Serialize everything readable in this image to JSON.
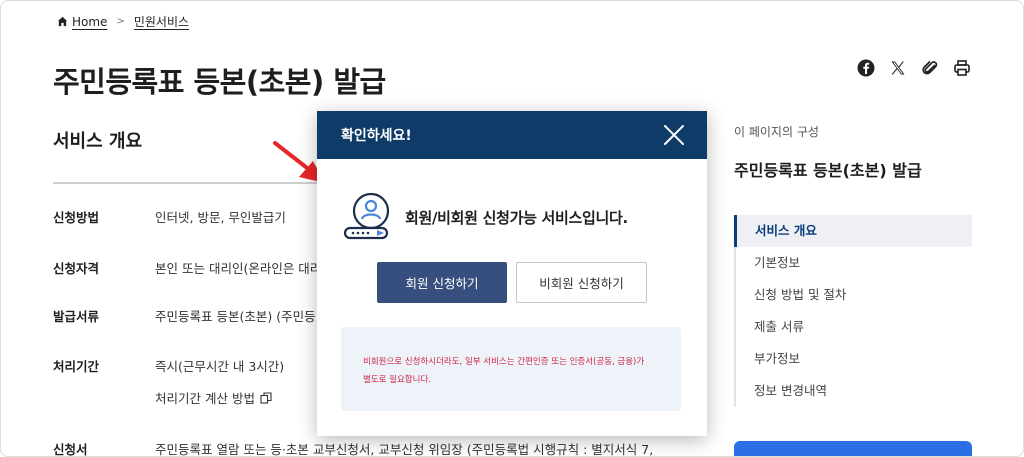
{
  "breadcrumb": {
    "home": "Home",
    "current": "민원서비스"
  },
  "page": {
    "title": "주민등록표 등본(초본) 발급"
  },
  "share_icons": [
    "facebook-icon",
    "x-icon",
    "paperclip-icon",
    "print-icon"
  ],
  "overview": {
    "title": "서비스 개요",
    "rows": [
      {
        "label": "신청방법",
        "value": "인터넷, 방문, 무인발급기"
      },
      {
        "label": "신청자격",
        "value": "본인 또는 대리인(온라인은 대리"
      },
      {
        "label": "발급서류",
        "value": "주민등록표 등본(초본) (주민등"
      },
      {
        "label": "처리기간",
        "value": "즉시(근무시간 내 3시간)"
      },
      {
        "label": "신청서",
        "value": "주민등록표 열람 또는 등·초본 교부신청서, 교부신청 위임장 (주민등록법 시행규칙 : 별지서식 7,"
      }
    ],
    "calc_link": "처리기간 계산 방법"
  },
  "toc": {
    "caption": "이 페이지의 구성",
    "title": "주민등록표 등본(초본) 발급",
    "items": [
      "서비스 개요",
      "기본정보",
      "신청 방법 및 절차",
      "제출 서류",
      "부가정보",
      "정보 변경내역"
    ]
  },
  "modal": {
    "title": "확인하세요!",
    "message": "회원/비회원 신청가능 서비스입니다.",
    "member_button": "회원 신청하기",
    "guest_button": "비회원 신청하기",
    "notice_line1": "비회원으로 신청하시더라도, 일부 서비스는 간편인증 또는 인증서(공동, 금융)가",
    "notice_line2": "별도로 필요합니다."
  },
  "colors": {
    "modal_header": "#0f3b69",
    "primary_button": "#364f7f",
    "notice_text": "#d0264a",
    "toc_active": "#0b3d7a",
    "arrow": "#e8262a"
  }
}
